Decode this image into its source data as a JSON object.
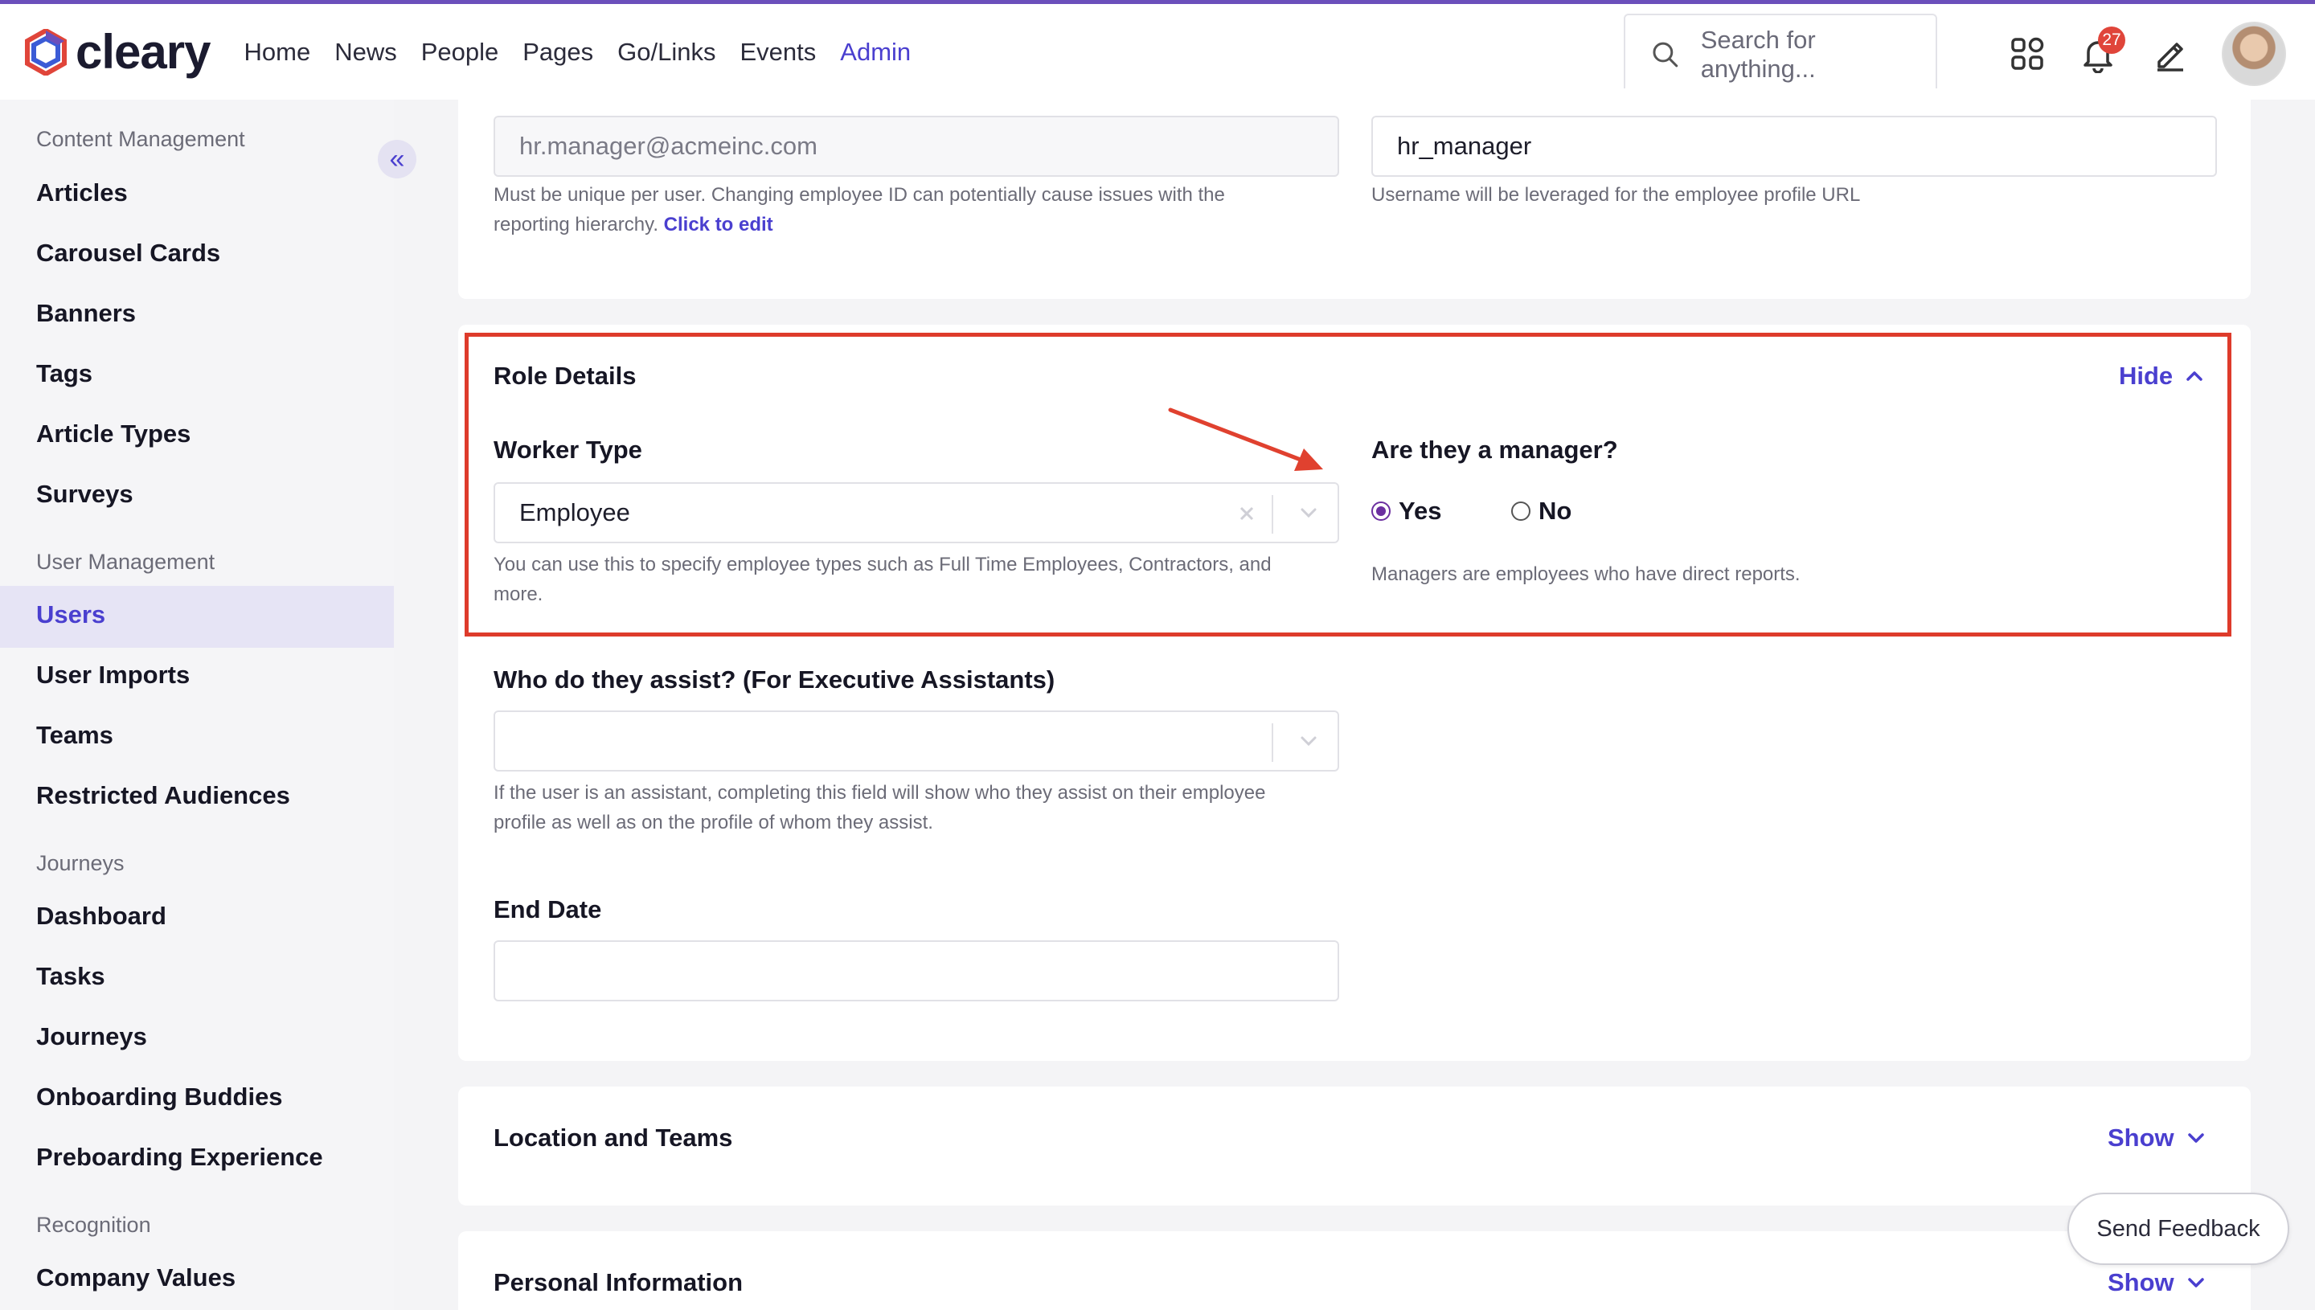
{
  "app": {
    "logo_text": "cleary"
  },
  "nav": {
    "items": [
      {
        "label": "Home"
      },
      {
        "label": "News"
      },
      {
        "label": "People"
      },
      {
        "label": "Pages"
      },
      {
        "label": "Go/Links"
      },
      {
        "label": "Events"
      },
      {
        "label": "Admin"
      }
    ],
    "active": "Admin"
  },
  "search": {
    "placeholder": "Search for anything..."
  },
  "header_icons": {
    "apps": "grid-icon",
    "notifications": "bell-icon",
    "compose": "pencil-icon",
    "notification_count": "27"
  },
  "sidebar": {
    "collapse_icon": "double-chevron-left-icon",
    "sections": [
      {
        "title": "Content Management",
        "items": [
          "Articles",
          "Carousel Cards",
          "Banners",
          "Tags",
          "Article Types",
          "Surveys"
        ]
      },
      {
        "title": "User Management",
        "items": [
          "Users",
          "User Imports",
          "Teams",
          "Restricted Audiences"
        ]
      },
      {
        "title": "Journeys",
        "items": [
          "Dashboard",
          "Tasks",
          "Journeys",
          "Onboarding Buddies",
          "Preboarding Experience"
        ]
      },
      {
        "title": "Recognition",
        "items": [
          "Company Values"
        ]
      }
    ],
    "active_item": "Users"
  },
  "identity": {
    "email_value": "hr.manager@acmeinc.com",
    "email_help": "Must be unique per user. Changing employee ID can potentially cause issues with the",
    "email_help_2": "reporting hierarchy.",
    "email_help_link": "Click to edit",
    "username_value": "hr_manager",
    "username_help": "Username will be leveraged for the employee profile URL"
  },
  "role_details": {
    "title": "Role Details",
    "toggle_label": "Hide",
    "worker_type_label": "Worker Type",
    "worker_type_value": "Employee",
    "worker_type_help": "You can use this to specify employee types such as Full Time Employees, Contractors, and",
    "worker_type_help_2": "more.",
    "manager_label": "Are they a manager?",
    "manager_options": [
      "Yes",
      "No"
    ],
    "manager_selected": "Yes",
    "manager_help": "Managers are employees who have direct reports.",
    "assist_label": "Who do they assist? (For Executive Assistants)",
    "assist_value": "",
    "assist_help": "If the user is an assistant, completing this field will show who they assist on their employee",
    "assist_help_2": "profile as well as on the profile of whom they assist.",
    "end_date_label": "End Date",
    "end_date_value": ""
  },
  "collapsed_sections": [
    {
      "title": "Location and Teams",
      "toggle_label": "Show"
    },
    {
      "title": "Personal Information",
      "toggle_label": "Show"
    }
  ],
  "feedback": {
    "label": "Send Feedback"
  },
  "colors": {
    "accent": "#4a3fcf",
    "highlight": "#de3b2b",
    "arrow": "#e0412f"
  }
}
